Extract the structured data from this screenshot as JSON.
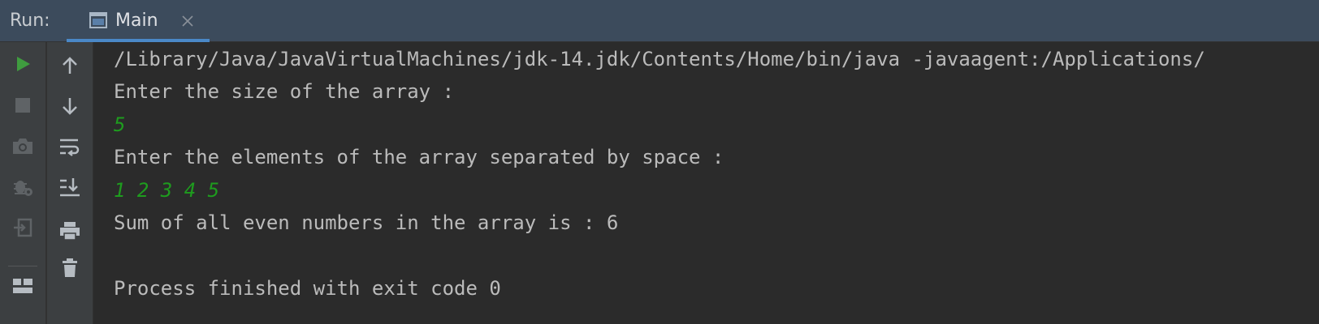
{
  "header": {
    "run_label": "Run:",
    "tab": {
      "label": "Main",
      "icon": "console-window-icon",
      "close_icon": "close-icon"
    }
  },
  "toolbar_left": [
    {
      "name": "rerun-button",
      "icon": "play-icon"
    },
    {
      "name": "stop-button",
      "icon": "stop-icon"
    },
    {
      "name": "thread-dump-button",
      "icon": "camera-icon"
    },
    {
      "name": "debug-settings-button",
      "icon": "bug-settings-icon"
    },
    {
      "name": "exit-button",
      "icon": "exit-icon"
    },
    {
      "name": "layout-button",
      "icon": "layout-icon"
    }
  ],
  "toolbar_right": [
    {
      "name": "scroll-up-button",
      "icon": "arrow-up-icon"
    },
    {
      "name": "scroll-down-button",
      "icon": "arrow-down-icon"
    },
    {
      "name": "soft-wrap-button",
      "icon": "soft-wrap-icon"
    },
    {
      "name": "scroll-to-end-button",
      "icon": "scroll-to-end-icon"
    },
    {
      "name": "print-button",
      "icon": "printer-icon"
    },
    {
      "name": "clear-all-button",
      "icon": "trash-icon"
    }
  ],
  "console": {
    "lines": [
      {
        "text": "/Library/Java/JavaVirtualMachines/jdk-14.jdk/Contents/Home/bin/java -javaagent:/Applications/",
        "type": "output"
      },
      {
        "text": "Enter the size of the array :",
        "type": "output"
      },
      {
        "text": "5",
        "type": "input"
      },
      {
        "text": "Enter the elements of the array separated by space :",
        "type": "output"
      },
      {
        "text": "1 2 3 4 5",
        "type": "input"
      },
      {
        "text": "Sum of all even numbers in the array is : 6",
        "type": "output"
      },
      {
        "text": "",
        "type": "output"
      },
      {
        "text": "Process finished with exit code 0",
        "type": "output"
      }
    ]
  },
  "colors": {
    "header_bg": "#3c4b5c",
    "toolbar_bg": "#3c3f41",
    "console_bg": "#2b2b2b",
    "output_text": "#bbbbbb",
    "input_text": "#1e9c1e",
    "tab_underline": "#4a88c7",
    "run_icon": "#3f9c3f"
  }
}
